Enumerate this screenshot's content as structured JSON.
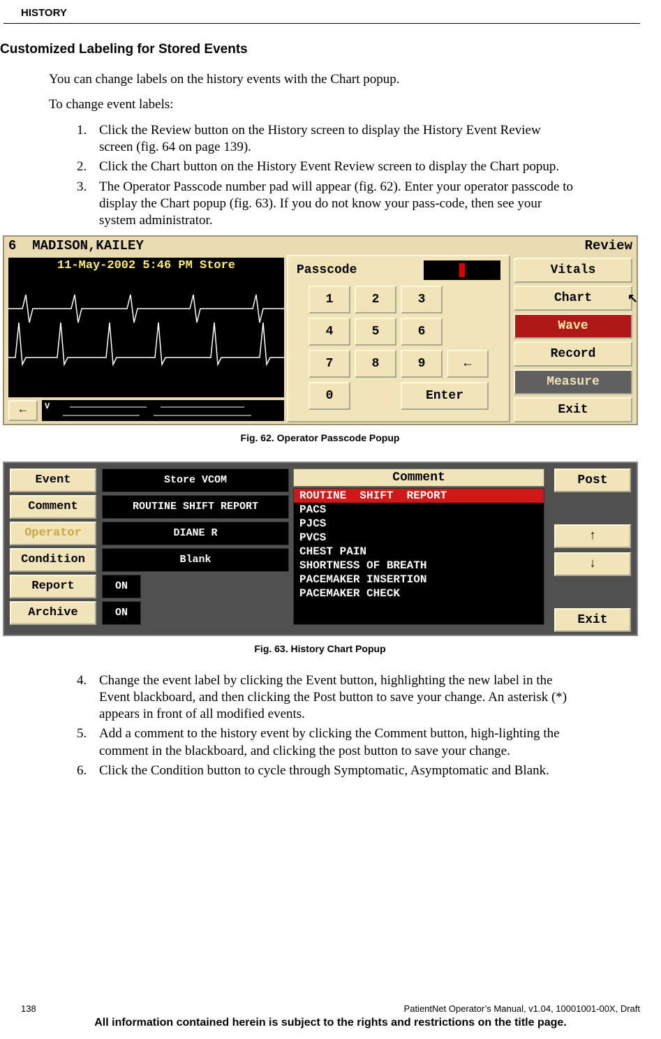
{
  "header": {
    "section": "HISTORY"
  },
  "h2": "Customized Labeling for Stored Events",
  "intro1": "You can change labels on the history events with the Chart popup.",
  "intro2": "To change event labels:",
  "steps": {
    "s1": {
      "n": "1.",
      "t": "Click the Review button on the History screen to display the History Event Review screen (fig. 64 on page 139)."
    },
    "s2": {
      "n": "2.",
      "t": "Click the Chart button on the History Event Review screen to display the Chart popup."
    },
    "s3": {
      "n": "3.",
      "t": "The Operator Passcode number pad will appear (fig. 62). Enter your operator passcode to display the Chart popup (fig. 63). If you do not know your pass-code, then see your system administrator."
    },
    "s4": {
      "n": "4.",
      "t": "Change the event label by clicking the Event button, highlighting the new label in the Event blackboard, and then clicking the Post button to save your change. An asterisk (*) appears in front of all modified events."
    },
    "s5": {
      "n": "5.",
      "t": "Add a comment to the history event by clicking the Comment button, high-lighting the comment in the blackboard, and clicking the post button to save your change."
    },
    "s6": {
      "n": "6.",
      "t": "Click the Condition button to cycle through Symptomatic, Asymptomatic and Blank."
    }
  },
  "fig62": {
    "caption": "Fig. 62. Operator Passcode Popup",
    "bed": "6",
    "patient": "MADISON,KAILEY",
    "mode": "Review",
    "timestamp": "11-May-2002  5:46 PM Store",
    "pass_label": "Passcode",
    "keys": {
      "k1": "1",
      "k2": "2",
      "k3": "3",
      "k4": "4",
      "k5": "5",
      "k6": "6",
      "k7": "7",
      "k8": "8",
      "k9": "9",
      "k0": "0",
      "back": "←",
      "enter": "Enter"
    },
    "side": {
      "vitals": "Vitals",
      "chart": "Chart",
      "wave": "Wave",
      "record": "Record",
      "measure": "Measure",
      "exit": "Exit"
    },
    "miniback": "←",
    "mini_label": "V"
  },
  "fig63": {
    "caption": "Fig. 63.  History Chart Popup",
    "left": {
      "event": "Event",
      "comment": "Comment",
      "operator": "Operator",
      "condition": "Condition",
      "report": "Report",
      "archive": "Archive"
    },
    "mid": {
      "event_val": "Store VCOM",
      "comment_val": "ROUTINE SHIFT REPORT",
      "operator_val": "DIANE R",
      "condition_val": "Blank",
      "report_val": "ON",
      "archive_val": "ON"
    },
    "list_header": "Comment",
    "list": {
      "i0": "ROUTINE  SHIFT  REPORT",
      "i1": "PACS",
      "i2": "PJCS",
      "i3": "PVCS",
      "i4": "CHEST PAIN",
      "i5": "SHORTNESS OF BREATH",
      "i6": "PACEMAKER INSERTION",
      "i7": "PACEMAKER CHECK"
    },
    "right": {
      "post": "Post",
      "up": "↑",
      "down": "↓",
      "exit": "Exit"
    }
  },
  "footer": {
    "page": "138",
    "right": "PatientNet Operator’s Manual, v1.04, 10001001-00X, Draft",
    "notice": "All information contained herein is subject to the rights and restrictions on the title page."
  }
}
